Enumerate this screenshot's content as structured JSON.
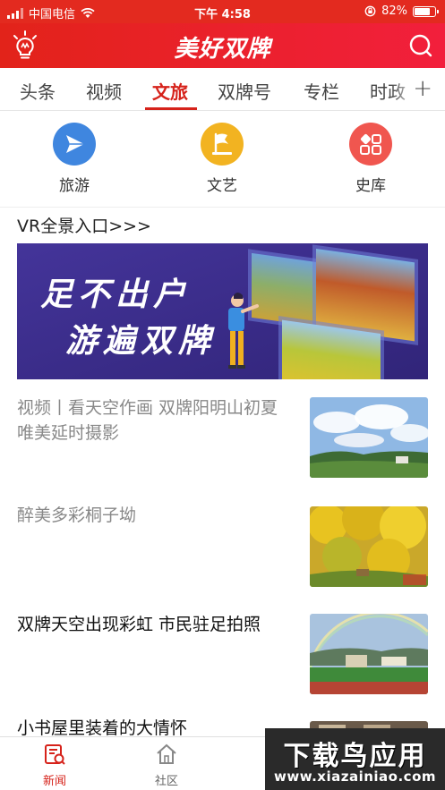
{
  "status_bar": {
    "carrier": "中国电信",
    "time": "下午 4:58",
    "battery": "82%",
    "battery_level": 0.82
  },
  "app_bar": {
    "title": "美好双牌",
    "icons": [
      "lightbulb-icon",
      "search-icon"
    ]
  },
  "tabs": {
    "items": [
      "头条",
      "视频",
      "文旅",
      "双牌号",
      "专栏",
      "时政"
    ],
    "active": "文旅",
    "more_icon": "plus-icon"
  },
  "categories": [
    {
      "label": "旅游",
      "icon": "paper-plane-icon",
      "color": "#3f86df"
    },
    {
      "label": "文艺",
      "icon": "flag-icon",
      "color": "#f2b321"
    },
    {
      "label": "史库",
      "icon": "grid-tiles-icon",
      "color": "#f0564f"
    }
  ],
  "vr_entry": "VR全景入口>>>",
  "banner": {
    "line1": "足不出户",
    "line2": "游遍双牌"
  },
  "news": [
    {
      "title": "视频丨看天空作画 双牌阳明山初夏唯美延时摄影",
      "read": true,
      "thumb": "sky-clouds-landscape"
    },
    {
      "title": "醉美多彩桐子坳",
      "read": true,
      "thumb": "golden-ginkgo-trees"
    },
    {
      "title": "双牌天空出现彩虹 市民驻足拍照",
      "read": false,
      "thumb": "rainbow-over-stadium"
    },
    {
      "title": "小书屋里装着的大情怀",
      "read": false,
      "thumb": "bookshelf-room"
    }
  ],
  "bottom_nav": [
    {
      "label": "新闻",
      "active": true,
      "icon": "news-icon"
    },
    {
      "label": "社区",
      "active": false,
      "icon": "home-icon"
    }
  ],
  "watermark": {
    "line1": "下载鸟应用",
    "line2": "www.xiazainiao.com"
  },
  "colors": {
    "brand_red": "#e2231a",
    "active_tab": "#d6221a",
    "banner_purple": "#3b2c89"
  }
}
